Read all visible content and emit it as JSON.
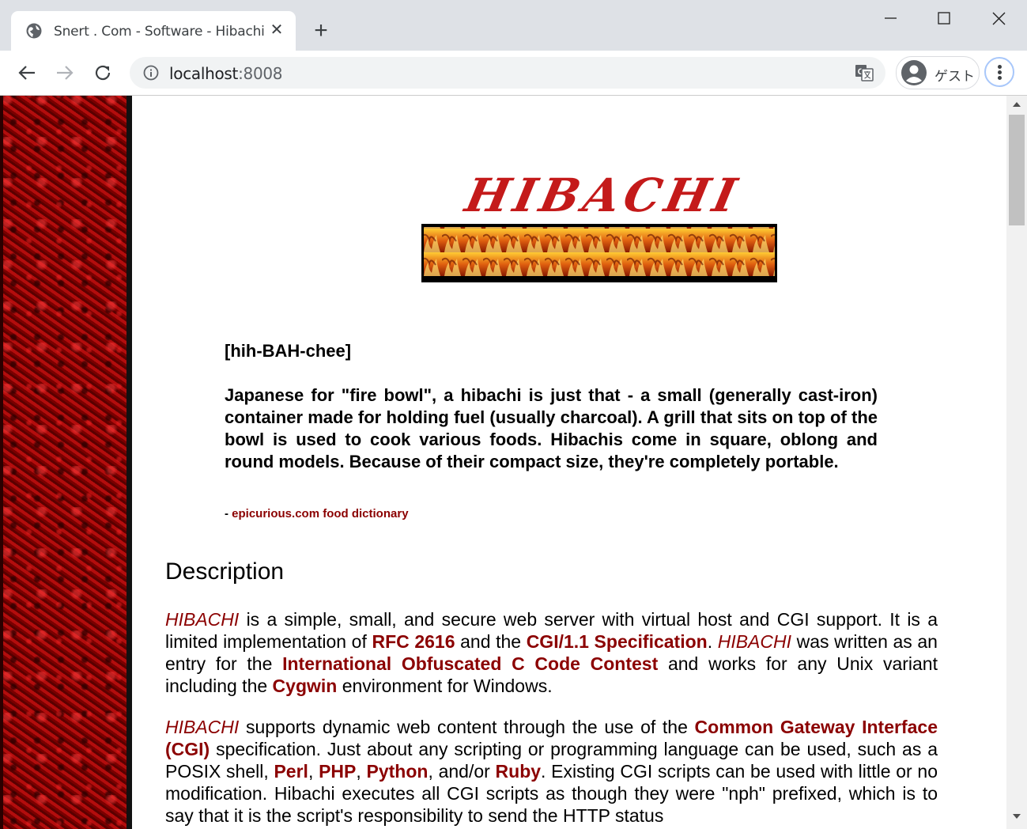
{
  "browser": {
    "tab_title": "Snert . Com - Software - Hibachi",
    "url_host": "localhost",
    "url_port": ":8008",
    "profile_label": "ゲスト"
  },
  "page": {
    "pronunciation": "[hih-BAH-chee]",
    "quote": "Japanese for \"fire bowl\", a hibachi is just that - a small (generally cast-iron) container made for holding fuel (usually charcoal). A grill that sits on top of the bowl is used to cook various foods. Hibachis come in square, oblong and round models. Because of their compact size, they're completely portable.",
    "cite_prefix": "- ",
    "cite_link": "epicurious.com food dictionary",
    "description_heading": "Description",
    "p1": {
      "hibachi": "HIBACHI",
      "t1": " is a simple, small, and secure web server with virtual host and CGI support. It is a limited implementation of ",
      "link_rfc": "RFC 2616",
      "t2": " and the ",
      "link_cgi_spec": "CGI/1.1 Specification",
      "t3": ". ",
      "hibachi2": "HIBACHI",
      "t4": " was written as an entry for the ",
      "link_ioccc": "International Obfuscated C Code Contest",
      "t5": " and works for any Unix variant including the ",
      "link_cygwin": "Cygwin",
      "t6": " environment for Windows."
    },
    "p2": {
      "hibachi": "HIBACHI",
      "t1": " supports dynamic web content through the use of the ",
      "link_cgi": "Common Gateway Interface (CGI)",
      "t2": " specification. Just about any scripting or programming language can be used, such as a POSIX shell, ",
      "link_perl": "Perl",
      "c1": ", ",
      "link_php": "PHP",
      "c2": ", ",
      "link_python": "Python",
      "t3": ", and/or ",
      "link_ruby": "Ruby",
      "t4": ". Existing CGI scripts can be used with little or no modification. Hibachi executes all CGI scripts as though they were \"nph\" prefixed, which is to say that it is the script's responsibility to send the HTTP status"
    },
    "logo_text": "HIBACHI"
  },
  "colors": {
    "link": "#8b0000",
    "sidebar_red": "#8f0000"
  }
}
